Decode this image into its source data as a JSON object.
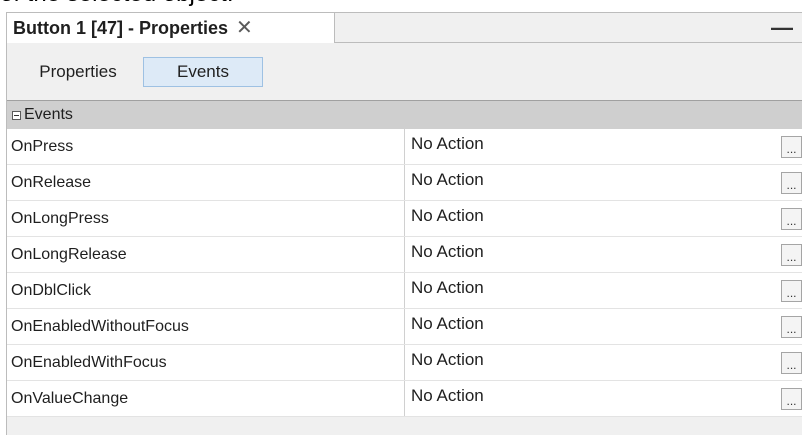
{
  "caption_fragment": "of the selected object.",
  "panel": {
    "title": "Button 1 [47] - Properties",
    "close_glyph": "✕",
    "minimize_glyph": "—"
  },
  "subtabs": {
    "properties_label": "Properties",
    "events_label": "Events",
    "active": "Events"
  },
  "group": {
    "label": "Events",
    "expanded": true
  },
  "rows": [
    {
      "name": "OnPress",
      "value": "No Action",
      "button": "..."
    },
    {
      "name": "OnRelease",
      "value": "No Action",
      "button": "..."
    },
    {
      "name": "OnLongPress",
      "value": "No Action",
      "button": "..."
    },
    {
      "name": "OnLongRelease",
      "value": "No Action",
      "button": "..."
    },
    {
      "name": "OnDblClick",
      "value": "No Action",
      "button": "..."
    },
    {
      "name": "OnEnabledWithoutFocus",
      "value": "No Action",
      "button": "..."
    },
    {
      "name": "OnEnabledWithFocus",
      "value": "No Action",
      "button": "..."
    },
    {
      "name": "OnValueChange",
      "value": "No Action",
      "button": "..."
    }
  ],
  "colors": {
    "panel_bg": "#f0f0f0",
    "active_subtab_bg": "#ddeaf7",
    "group_header_bg": "#cfcfcf"
  }
}
